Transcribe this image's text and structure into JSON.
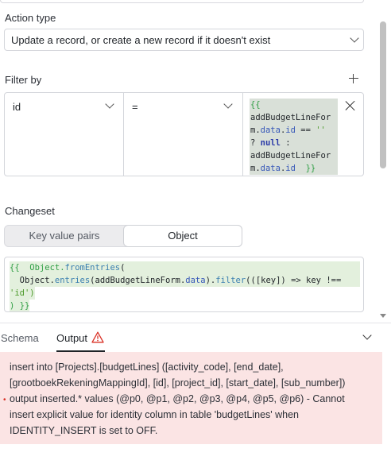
{
  "action_type": {
    "label": "Action type",
    "value": "Update a record, or create a new record if it doesn't exist"
  },
  "filter": {
    "label": "Filter by",
    "column": "id",
    "operator": "=",
    "expression": {
      "l1": "{{",
      "l2": "addBudgetLineFor",
      "l3a": "m.",
      "l3b": "data",
      "l3c": ".",
      "l3d": "id",
      "l3e": " == ",
      "l3f": "''",
      "l4a": "? ",
      "l4b": "null",
      "l4c": " :",
      "l5": "addBudgetLineFor",
      "l6a": "m.",
      "l6b": "data",
      "l6c": ".",
      "l6d": "id",
      "l6e": "  }}"
    }
  },
  "changeset": {
    "label": "Changeset",
    "tab_kv": "Key value pairs",
    "tab_object": "Object",
    "code": {
      "l1a": "{{  Object.",
      "l1b": "fromEntries",
      "l1c": "(",
      "l2a": "  Object.",
      "l2b": "entries",
      "l2c": "(addBudgetLineForm.",
      "l2d": "data",
      "l2e": ").",
      "l2f": "filter",
      "l2g": "(([key]) => key !==",
      "l3": "'id')",
      "l4": ") }}"
    }
  },
  "bottom_panel": {
    "tab_schema": "Schema",
    "tab_output": "Output",
    "error_message": "insert into [Projects].[budgetLines] ([activity_code], [end_date], [grootboekRekeningMappingId], [id], [project_id], [start_date], [sub_number]) output inserted.* values (@p0, @p1, @p2, @p3, @p4, @p5, @p6) - Cannot insert explicit value for identity column in table 'budgetLines' when IDENTITY_INSERT is set to OFF."
  },
  "colors": {
    "error_bg": "#fbe4e4",
    "warning": "#d93025",
    "code_highlight": "#e3f0dd"
  }
}
